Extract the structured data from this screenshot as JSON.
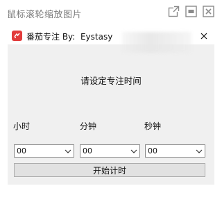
{
  "viewer": {
    "title": "鼠标滚轮缩放图片",
    "icons": [
      "open-external-icon",
      "restore-icon",
      "close-icon"
    ]
  },
  "app": {
    "logo_icon": "tomato-logo-icon",
    "title": "番茄专注 By:  Eystasy",
    "close_icon": "close-icon",
    "prompt": "请设定专注时间",
    "units": {
      "hours": "小时",
      "minutes": "分钟",
      "seconds": "秒钟"
    },
    "dropdowns": {
      "hours": "00",
      "minutes": "00",
      "seconds": "00"
    },
    "start_button": "开始计时",
    "colors": {
      "window_bg": "#f0f0f0",
      "logo": "#e23b3b",
      "button_bg": "#e1e1e1"
    }
  }
}
